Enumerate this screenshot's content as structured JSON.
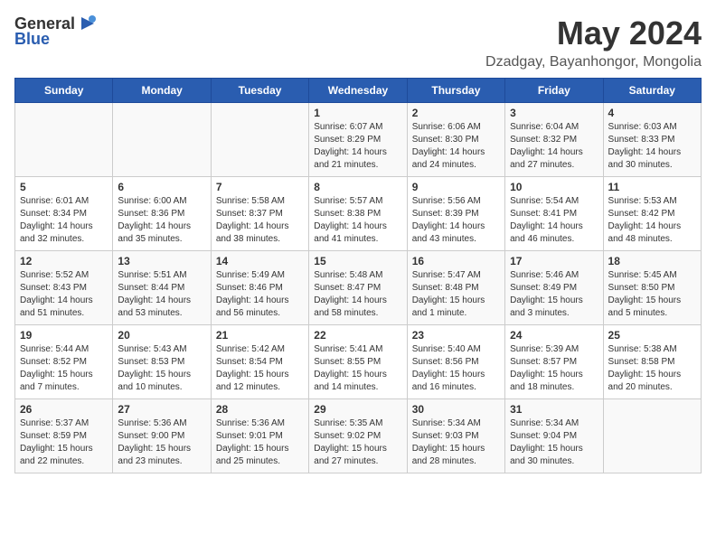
{
  "header": {
    "logo": {
      "general": "General",
      "blue": "Blue",
      "icon": "▶"
    },
    "title": "May 2024",
    "location": "Dzadgay, Bayanhongor, Mongolia"
  },
  "weekdays": [
    "Sunday",
    "Monday",
    "Tuesday",
    "Wednesday",
    "Thursday",
    "Friday",
    "Saturday"
  ],
  "weeks": [
    [
      {
        "day": "",
        "text": ""
      },
      {
        "day": "",
        "text": ""
      },
      {
        "day": "",
        "text": ""
      },
      {
        "day": "1",
        "text": "Sunrise: 6:07 AM\nSunset: 8:29 PM\nDaylight: 14 hours\nand 21 minutes."
      },
      {
        "day": "2",
        "text": "Sunrise: 6:06 AM\nSunset: 8:30 PM\nDaylight: 14 hours\nand 24 minutes."
      },
      {
        "day": "3",
        "text": "Sunrise: 6:04 AM\nSunset: 8:32 PM\nDaylight: 14 hours\nand 27 minutes."
      },
      {
        "day": "4",
        "text": "Sunrise: 6:03 AM\nSunset: 8:33 PM\nDaylight: 14 hours\nand 30 minutes."
      }
    ],
    [
      {
        "day": "5",
        "text": "Sunrise: 6:01 AM\nSunset: 8:34 PM\nDaylight: 14 hours\nand 32 minutes."
      },
      {
        "day": "6",
        "text": "Sunrise: 6:00 AM\nSunset: 8:36 PM\nDaylight: 14 hours\nand 35 minutes."
      },
      {
        "day": "7",
        "text": "Sunrise: 5:58 AM\nSunset: 8:37 PM\nDaylight: 14 hours\nand 38 minutes."
      },
      {
        "day": "8",
        "text": "Sunrise: 5:57 AM\nSunset: 8:38 PM\nDaylight: 14 hours\nand 41 minutes."
      },
      {
        "day": "9",
        "text": "Sunrise: 5:56 AM\nSunset: 8:39 PM\nDaylight: 14 hours\nand 43 minutes."
      },
      {
        "day": "10",
        "text": "Sunrise: 5:54 AM\nSunset: 8:41 PM\nDaylight: 14 hours\nand 46 minutes."
      },
      {
        "day": "11",
        "text": "Sunrise: 5:53 AM\nSunset: 8:42 PM\nDaylight: 14 hours\nand 48 minutes."
      }
    ],
    [
      {
        "day": "12",
        "text": "Sunrise: 5:52 AM\nSunset: 8:43 PM\nDaylight: 14 hours\nand 51 minutes."
      },
      {
        "day": "13",
        "text": "Sunrise: 5:51 AM\nSunset: 8:44 PM\nDaylight: 14 hours\nand 53 minutes."
      },
      {
        "day": "14",
        "text": "Sunrise: 5:49 AM\nSunset: 8:46 PM\nDaylight: 14 hours\nand 56 minutes."
      },
      {
        "day": "15",
        "text": "Sunrise: 5:48 AM\nSunset: 8:47 PM\nDaylight: 14 hours\nand 58 minutes."
      },
      {
        "day": "16",
        "text": "Sunrise: 5:47 AM\nSunset: 8:48 PM\nDaylight: 15 hours\nand 1 minute."
      },
      {
        "day": "17",
        "text": "Sunrise: 5:46 AM\nSunset: 8:49 PM\nDaylight: 15 hours\nand 3 minutes."
      },
      {
        "day": "18",
        "text": "Sunrise: 5:45 AM\nSunset: 8:50 PM\nDaylight: 15 hours\nand 5 minutes."
      }
    ],
    [
      {
        "day": "19",
        "text": "Sunrise: 5:44 AM\nSunset: 8:52 PM\nDaylight: 15 hours\nand 7 minutes."
      },
      {
        "day": "20",
        "text": "Sunrise: 5:43 AM\nSunset: 8:53 PM\nDaylight: 15 hours\nand 10 minutes."
      },
      {
        "day": "21",
        "text": "Sunrise: 5:42 AM\nSunset: 8:54 PM\nDaylight: 15 hours\nand 12 minutes."
      },
      {
        "day": "22",
        "text": "Sunrise: 5:41 AM\nSunset: 8:55 PM\nDaylight: 15 hours\nand 14 minutes."
      },
      {
        "day": "23",
        "text": "Sunrise: 5:40 AM\nSunset: 8:56 PM\nDaylight: 15 hours\nand 16 minutes."
      },
      {
        "day": "24",
        "text": "Sunrise: 5:39 AM\nSunset: 8:57 PM\nDaylight: 15 hours\nand 18 minutes."
      },
      {
        "day": "25",
        "text": "Sunrise: 5:38 AM\nSunset: 8:58 PM\nDaylight: 15 hours\nand 20 minutes."
      }
    ],
    [
      {
        "day": "26",
        "text": "Sunrise: 5:37 AM\nSunset: 8:59 PM\nDaylight: 15 hours\nand 22 minutes."
      },
      {
        "day": "27",
        "text": "Sunrise: 5:36 AM\nSunset: 9:00 PM\nDaylight: 15 hours\nand 23 minutes."
      },
      {
        "day": "28",
        "text": "Sunrise: 5:36 AM\nSunset: 9:01 PM\nDaylight: 15 hours\nand 25 minutes."
      },
      {
        "day": "29",
        "text": "Sunrise: 5:35 AM\nSunset: 9:02 PM\nDaylight: 15 hours\nand 27 minutes."
      },
      {
        "day": "30",
        "text": "Sunrise: 5:34 AM\nSunset: 9:03 PM\nDaylight: 15 hours\nand 28 minutes."
      },
      {
        "day": "31",
        "text": "Sunrise: 5:34 AM\nSunset: 9:04 PM\nDaylight: 15 hours\nand 30 minutes."
      },
      {
        "day": "",
        "text": ""
      }
    ]
  ]
}
